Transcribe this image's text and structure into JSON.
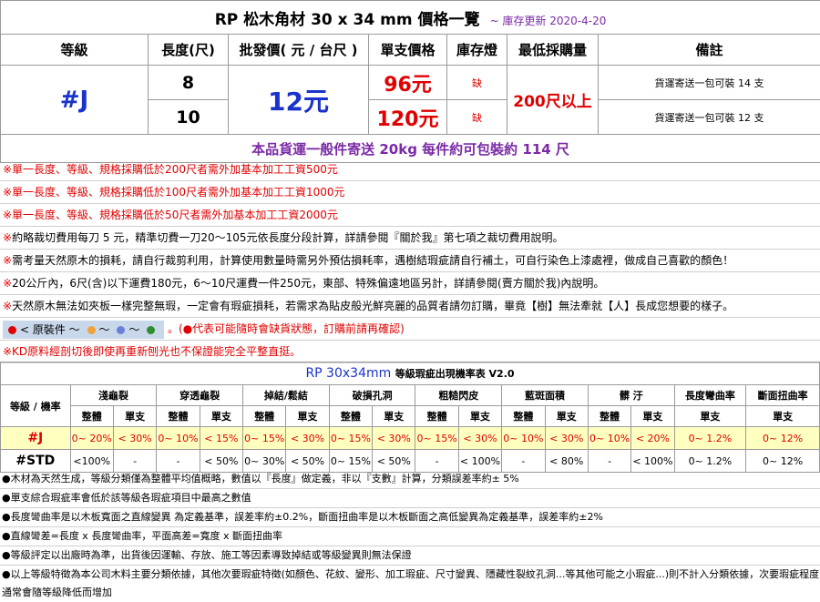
{
  "title": {
    "main": "RP 松木角材 30 x 34 mm 價格一覽",
    "note": "~ 庫存更新 2020-4-20"
  },
  "headers": [
    "等級",
    "長度(尺)",
    "批發價( 元 / 台尺 )",
    "單支價格",
    "庫存燈",
    "最低採購量",
    "備註"
  ],
  "product": {
    "grade": "#J",
    "wholesale_price": "12元",
    "min_purchase": "200尺以上",
    "rows": [
      {
        "length": "8",
        "unit_price": "96元",
        "stock": "缺",
        "remark": "貨運寄送一包可裝 14 支"
      },
      {
        "length": "10",
        "unit_price": "120元",
        "stock": "缺",
        "remark": "貨運寄送一包可裝 12 支"
      }
    ]
  },
  "shipping": "本品貨運一般件寄送 20kg 每件約可包裝約 114 尺",
  "notes": [
    "※單一長度、等級、規格採購低於200尺者需外加基本加工工資500元",
    "※單一長度、等級、規格採購低於100尺者需外加基本加工工資1000元",
    "※單一長度、等級、規格採購低於50尺者需外加基本加工工資2000元",
    "※約略裁切費用每刀 5 元，精準切費一刀20～105元依長度分段計算，詳請參閱『關於我』第七項之裁切費用說明。",
    "※需考量天然原木的損耗，請自行裁剪利用，計算使用數量時需另外預估損耗率，遇樹結瑕疵請自行補土，可自行染色上漆處裡，做成自己喜歡的顏色！",
    "※20公斤內，6尺(含)以下運費180元，6～10尺運費一件250元，東部、特殊偏遠地區另計，詳請參閱(賣方關於我)內說明。",
    "※天然原木無法如夾板一樣完整無瑕，一定會有瑕疵損耗，若需求為貼皮般光鮮亮麗的品質者請勿訂購，畢竟【樹】無法牽就【人】長成您想要的樣子。"
  ],
  "legend": {
    "label": "< 原裝件 ～",
    "sep": "～",
    "note": "。(●代表可能隨時會缺貨狀態，訂購前請再確認)",
    "colors": [
      "#e00000",
      "#f2a23a",
      "#6a7fd8",
      "#2e8b2e"
    ]
  },
  "kd_note": "※KD原料經剖切後即使再重新刨光也不保證能完全平整直挺。",
  "defects": {
    "title": "RP 30x34mm",
    "title_suffix": "等級瑕疵出現機率表 V2.0",
    "row_header": "等級 / 機率",
    "groups": [
      "淺龜裂",
      "穿透龜裂",
      "掉結/鬆結",
      "破損孔洞",
      "粗糙閃皮",
      "藍斑面積",
      "髒 汙"
    ],
    "sub": [
      "整體",
      "單支"
    ],
    "extra": [
      "長度彎曲率",
      "斷面扭曲率"
    ],
    "extra_sub": "單支",
    "rows": [
      {
        "grade": "#J",
        "cells": [
          "0~ 20%",
          "< 30%",
          "0~ 10%",
          "< 15%",
          "0~ 15%",
          "< 30%",
          "0~ 15%",
          "< 30%",
          "0~ 15%",
          "< 30%",
          "0~ 10%",
          "< 30%",
          "0~ 10%",
          "< 20%",
          "0~ 1.2%",
          "0~ 12%"
        ]
      },
      {
        "grade": "#STD",
        "cells": [
          "<100%",
          "-",
          "-",
          "< 50%",
          "0~ 30%",
          "< 50%",
          "0~ 15%",
          "< 50%",
          "-",
          "< 100%",
          "-",
          "< 80%",
          "-",
          "< 100%",
          "0~ 1.2%",
          "0~ 12%"
        ]
      }
    ]
  },
  "bottom_notes": [
    "●木材為天然生成，等級分類僅為整體平均值概略，數值以『長度』做定義，非以『支數』計算，分類誤差率約± 5%",
    "●單支綜合瑕疵率會低於該等級各瑕疵項目中最高之數值",
    "●長度彎曲率是以木板寬面之直線變異 為定義基準，誤差率約±0.2%，斷面扭曲率是以木板斷面之高低變異為定義基準，誤差率約±2%",
    "●直線彎差=長度 x 長度彎曲率，平面高差=寬度 x 斷面扭曲率",
    "●等級評定以出廠時為準，出貨後因運輸、存放、施工等因素導致掉結或等級變異則無法保證",
    "●以上等級特徵為本公司木料主要分類依據，其他次要瑕疵特徵(如顏色、花紋、變形、加工瑕疵、尺寸變異、隱藏性裂紋孔洞...等其他可能之小瑕疵...)則不計入分類依據，次要瑕疵程度通常會隨等級降低而增加"
  ]
}
